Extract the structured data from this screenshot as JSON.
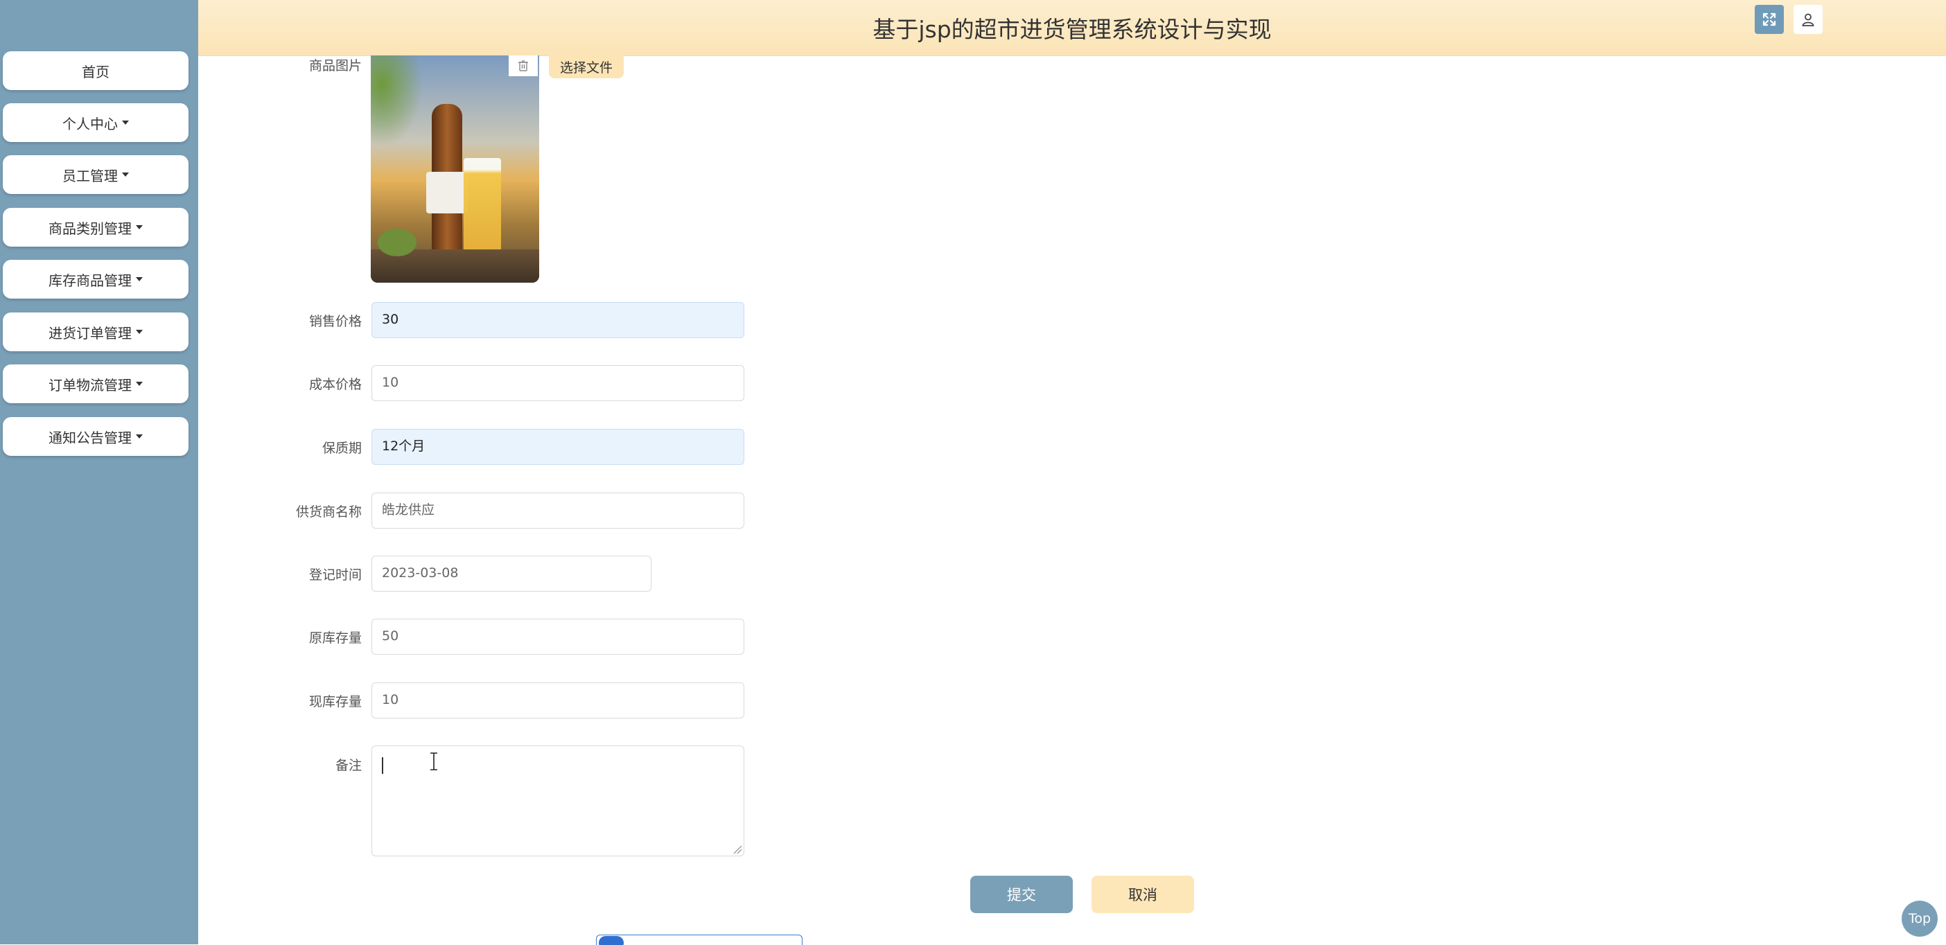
{
  "header": {
    "title": "基于jsp的超市进货管理系统设计与实现"
  },
  "sidebar": {
    "items": [
      {
        "label": "首页"
      },
      {
        "label": "个人中心"
      },
      {
        "label": "员工管理"
      },
      {
        "label": "商品类别管理"
      },
      {
        "label": "库存商品管理"
      },
      {
        "label": "进货订单管理"
      },
      {
        "label": "订单物流管理"
      },
      {
        "label": "通知公告管理"
      }
    ]
  },
  "form": {
    "image_label": "商品图片",
    "choose_file_label": "选择文件",
    "fields": [
      {
        "label": "销售价格",
        "value": "30"
      },
      {
        "label": "成本价格",
        "value": "10"
      },
      {
        "label": "保质期",
        "value": "12个月"
      },
      {
        "label": "供货商名称",
        "value": "皓龙供应"
      },
      {
        "label": "登记时间",
        "value": "2023-03-08"
      },
      {
        "label": "原库存量",
        "value": "50"
      },
      {
        "label": "现库存量",
        "value": "10"
      }
    ],
    "remark_label": "备注",
    "remark_value": ""
  },
  "buttons": {
    "submit": "提交",
    "cancel": "取消",
    "top": "Top"
  },
  "colors": {
    "sidebar": "#7aa0b8",
    "header_top": "#fdeecf",
    "submit": "#7aa0b8",
    "cancel": "#fde6b8",
    "filled_field": "#e8f3fe"
  }
}
